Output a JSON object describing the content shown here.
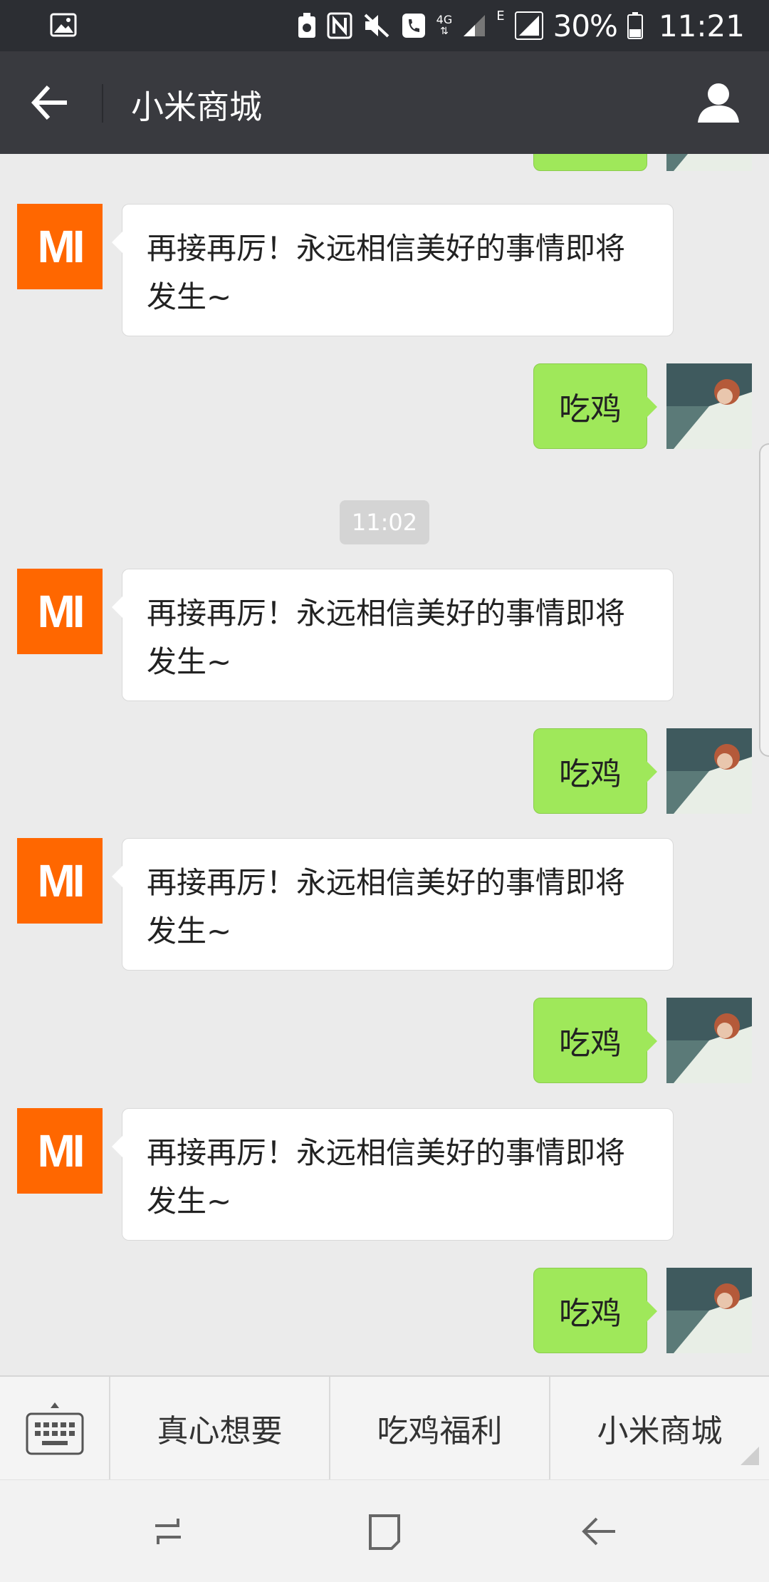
{
  "status_bar": {
    "battery": "30%",
    "time": "11:21",
    "network_4g": "4G",
    "network_e": "E",
    "icons": [
      "image-icon",
      "recycle-icon",
      "nfc-icon",
      "mute-icon",
      "call-icon",
      "signal-icon",
      "battery-icon"
    ]
  },
  "app_bar": {
    "title": "小米商城",
    "back_icon": "arrow-left-icon",
    "profile_icon": "person-icon"
  },
  "chat": {
    "timestamp": "11:02",
    "messages": [
      {
        "side": "out",
        "text": "吃鸡"
      },
      {
        "side": "in",
        "text": "再接再厉！永远相信美好的事情即将发生~"
      },
      {
        "side": "out",
        "text": "吃鸡"
      },
      {
        "side": "in",
        "text": "再接再厉！永远相信美好的事情即将发生~"
      },
      {
        "side": "out",
        "text": "吃鸡"
      },
      {
        "side": "in",
        "text": "再接再厉！永远相信美好的事情即将发生~"
      },
      {
        "side": "out",
        "text": "吃鸡"
      },
      {
        "side": "in",
        "text": "再接再厉！永远相信美好的事情即将发生~"
      },
      {
        "side": "out",
        "text": "吃鸡"
      }
    ],
    "brand_color": "#ff6700",
    "out_bubble_color": "#9fe85a",
    "mi_logo_text": "MI"
  },
  "menu": {
    "keyboard_icon": "keyboard-icon",
    "items": [
      {
        "label": "真心想要"
      },
      {
        "label": "吃鸡福利"
      },
      {
        "label": "小米商城"
      }
    ]
  },
  "nav_bar": {
    "icons": [
      "recent-apps-icon",
      "home-icon",
      "back-icon"
    ]
  }
}
